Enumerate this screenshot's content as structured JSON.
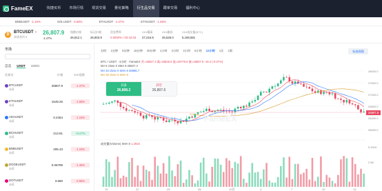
{
  "nav": {
    "logo": "FameEX",
    "items": [
      "快捷买币",
      "市场行情",
      "现货交易",
      "量化策略",
      "衍生品交易",
      "跟单交易",
      "福利中心"
    ],
    "active_index": 4
  },
  "tickers": [
    {
      "sym": "BNBUSDT",
      "chg": "-1.15%"
    },
    {
      "sym": "SOLUSDT",
      "chg": "-3.58%"
    },
    {
      "sym": "ETHUSDT",
      "chg": "-1.47%"
    },
    {
      "sym": "ETHUSDT",
      "chg": "-1.58%"
    }
  ],
  "pair": {
    "coin_glyph": "₿",
    "symbol": "BTCUSDT",
    "star": "☆",
    "subtitle": "永续合约 ▾",
    "last_price": "26,807.9",
    "change": "-1.47%",
    "stats": [
      {
        "label": "指数价格",
        "value": "26,812.1"
      },
      {
        "label": "标记价格",
        "value": "26,803.9"
      },
      {
        "label": "资金费率",
        "value": "0.0000% / 03:42:03",
        "red": true
      },
      {
        "label": "24H最高",
        "value": "27,216.9"
      },
      {
        "label": "24H最低",
        "value": "26,526.0"
      },
      {
        "label": "24H成交量(BTC)",
        "value": "5,169,581"
      }
    ]
  },
  "left": {
    "title": "市场",
    "tabs": [
      "自选",
      "USDT",
      "USDC"
    ],
    "active_tab": 1,
    "headers": {
      "pair": "交易对",
      "price": "价格",
      "change": "24H涨跌"
    },
    "rows": [
      {
        "sym": "BTCUSDT",
        "tag": "永续",
        "price": "26807.9",
        "chg": "-1.47%",
        "dir": "neg",
        "color": "#6f42c1"
      },
      {
        "sym": "ETHUSDT",
        "tag": "永续",
        "price": "1549.26",
        "chg": "-1.58%",
        "dir": "neg",
        "color": "#6f42c1"
      },
      {
        "sym": "ADAUSDT",
        "tag": "永续",
        "price": "0.2454",
        "chg": "-1.16%",
        "dir": "neg",
        "color": "#2a78ff"
      },
      {
        "sym": "BCHUSDT",
        "tag": "永续",
        "price": "213.81",
        "chg": "+0.07%",
        "dir": "pos",
        "color": "#2dbd85"
      },
      {
        "sym": "BNBUSDT",
        "tag": "永续",
        "price": "205.43",
        "chg": "-1.15%",
        "dir": "neg",
        "color": "#f3ba2f"
      },
      {
        "sym": "DOGEUSDT",
        "tag": "永续",
        "price": "0.05799",
        "chg": "-1.45%",
        "dir": "neg",
        "color": "#c2a633"
      },
      {
        "sym": "DOTUSDT",
        "tag": "永续",
        "price": "3.680",
        "chg": "-2.56%",
        "dir": "neg",
        "color": "#e6007a"
      }
    ]
  },
  "chart": {
    "timeframes": [
      "分时",
      "1分钟",
      "5分钟",
      "15分钟",
      "30分钟",
      "1小时",
      "2小时",
      "4小时",
      "6小时",
      "12小时",
      "1天",
      "1周"
    ],
    "active_tf": 9,
    "original_btn": "标准视图",
    "legend_line1": "BTC / USDT · 4小时 · FameEX",
    "legend_ohlc": "开=26827.3  高=26845.5  低=26779.6  收=26807.9  -19.4 (-0.07%)",
    "ma5": "MA 5 close 0 SMA 9  26827.4",
    "ma10": "MA 10 close 0 SMA 9  26885.7",
    "ma30": "MA 30 close 0 SMA 9",
    "buy_label": "开多",
    "buy_price": "26,808.2",
    "sell_label": "开空",
    "sell_price": "26,807.6",
    "watermark": "FameEX",
    "vol_legend": "成交量(Volume) SMA 9",
    "vol_value": "1.291K",
    "last_price_tag": "26807.9",
    "price_axis": [
      "28000.0",
      "27600.0",
      "27200.0",
      "26800.0",
      "26400.0",
      "26000.0"
    ],
    "vol_axis": [
      "5.291K",
      "2.5K"
    ],
    "x_axis": [
      "19",
      "22",
      "25",
      "28",
      "10月",
      "4",
      "7",
      "10",
      "13"
    ],
    "colors": {
      "up": "#2dbd85",
      "down": "#e8485f",
      "ma5": "#e8485f",
      "ma10": "#2a78ff",
      "ma30": "#d89a2a"
    }
  }
}
